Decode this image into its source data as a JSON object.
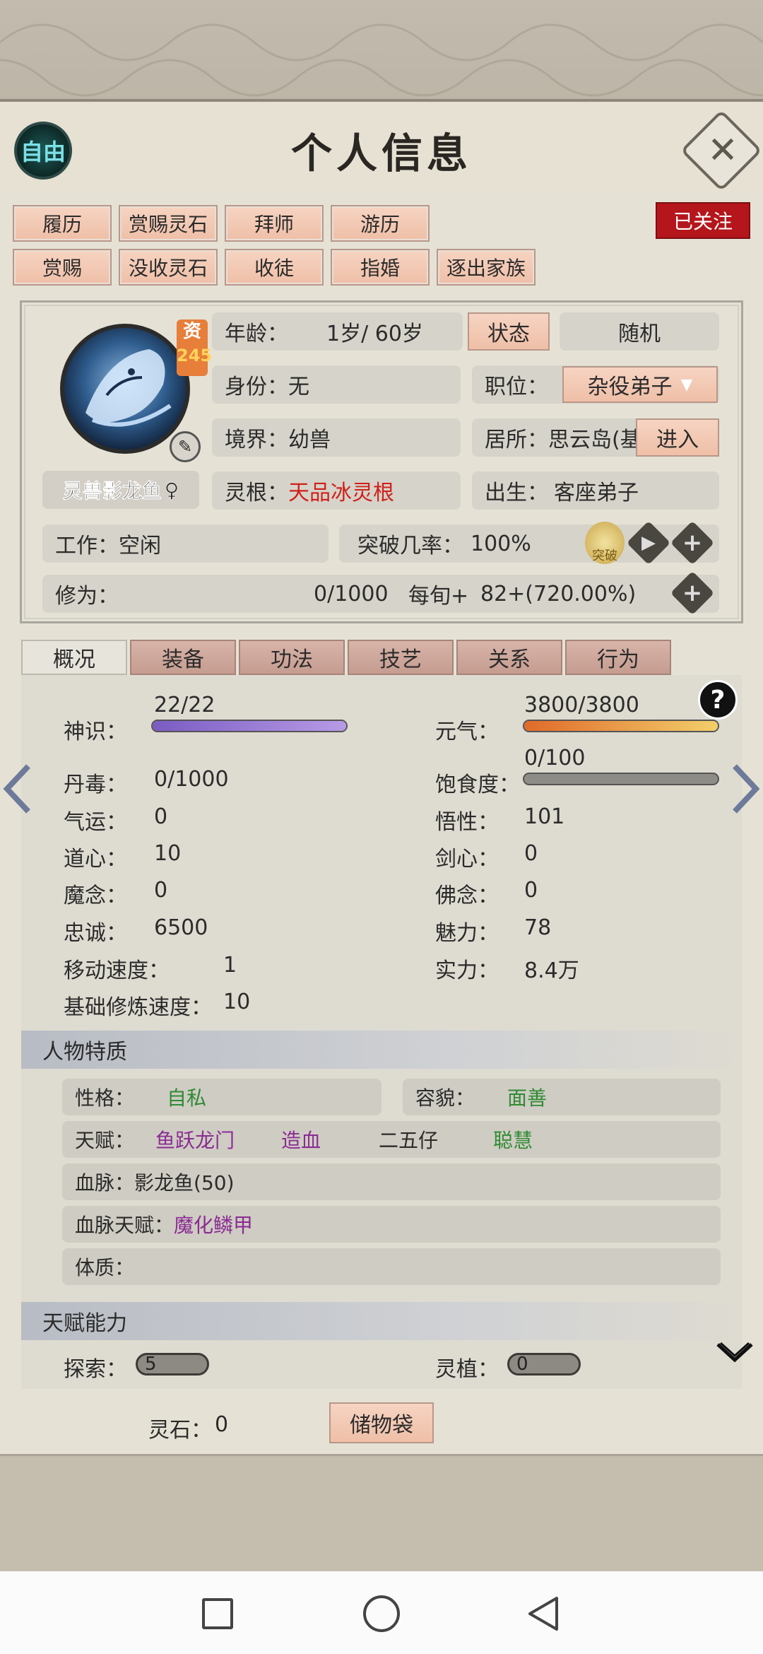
{
  "header": {
    "free_label": "自由",
    "title": "个人信息",
    "close_icon": "close-icon"
  },
  "follow_label": "已关注",
  "action_buttons": {
    "row1": [
      "履历",
      "赏赐灵石",
      "拜师",
      "游历"
    ],
    "row2": [
      "赏赐",
      "没收灵石",
      "收徒",
      "指婚",
      "逐出家族"
    ]
  },
  "profile": {
    "res_label": "资",
    "res_value": "245",
    "name": "灵兽影龙鱼",
    "gender_symbol": "♀",
    "age_label": "年龄：",
    "age_value": "1岁/ 60岁",
    "state_button": "状态",
    "random_button": "随机",
    "identity_label": "身份：",
    "identity_value": "无",
    "position_label": "职位：",
    "position_value": "杂役弟子",
    "realm_label": "境界：",
    "realm_value": "幼兽",
    "residence_label": "居所：",
    "residence_value": "思云岛(基",
    "enter_button": "进入",
    "root_label": "灵根：",
    "root_value": "天品冰灵根",
    "birth_label": "出生：",
    "birth_value": "客座弟子",
    "work_label": "工作：",
    "work_value": "空闲",
    "breakthrough_label": "突破几率：",
    "breakthrough_value": "100%",
    "breakthrough_badge": "突破",
    "cultivation_label": "修为：",
    "cultivation_value": "0/1000",
    "per_xun_label": "每旬+",
    "per_xun_value": "82+(720.00%)"
  },
  "tabs": [
    "概况",
    "装备",
    "功法",
    "技艺",
    "关系",
    "行为"
  ],
  "stats": {
    "help_icon": "?",
    "shenshi_label": "神识：",
    "shenshi_value": "22/22",
    "shenshi_fill": 1.0,
    "yuanqi_label": "元气：",
    "yuanqi_value": "3800/3800",
    "yuanqi_fill": 1.0,
    "dandu_label": "丹毒：",
    "dandu_value": "0/1000",
    "baoshi_label": "饱食度：",
    "baoshi_value": "0/100",
    "baoshi_fill": 0.0,
    "left": [
      {
        "label": "气运：",
        "value": "0"
      },
      {
        "label": "道心：",
        "value": "10"
      },
      {
        "label": "魔念：",
        "value": "0"
      },
      {
        "label": "忠诚：",
        "value": "6500"
      },
      {
        "label": "移动速度：",
        "value": "1"
      }
    ],
    "right": [
      {
        "label": "悟性：",
        "value": "101"
      },
      {
        "label": "剑心：",
        "value": "0"
      },
      {
        "label": "佛念：",
        "value": "0"
      },
      {
        "label": "魅力：",
        "value": "78"
      },
      {
        "label": "实力：",
        "value": "8.4万"
      }
    ],
    "base_speed_label": "基础修炼速度：",
    "base_speed_value": "10"
  },
  "traits": {
    "heading": "人物特质",
    "personality_label": "性格：",
    "personality_value": "自私",
    "appearance_label": "容貌：",
    "appearance_value": "面善",
    "talent_label": "天赋：",
    "talents": [
      "鱼跃龙门",
      "造血",
      "二五仔",
      "聪慧"
    ],
    "bloodline_label": "血脉：",
    "bloodline_value": "影龙鱼(50)",
    "bloodline_talent_label": "血脉天赋：",
    "bloodline_talent_value": "魔化鳞甲",
    "physique_label": "体质："
  },
  "abilities": {
    "heading": "天赋能力",
    "explore_label": "探索：",
    "explore_value": "5",
    "planting_label": "灵植：",
    "planting_value": "0"
  },
  "footer": {
    "spirit_stone_label": "灵石：",
    "spirit_stone_value": "0",
    "storage_button": "储物袋"
  }
}
